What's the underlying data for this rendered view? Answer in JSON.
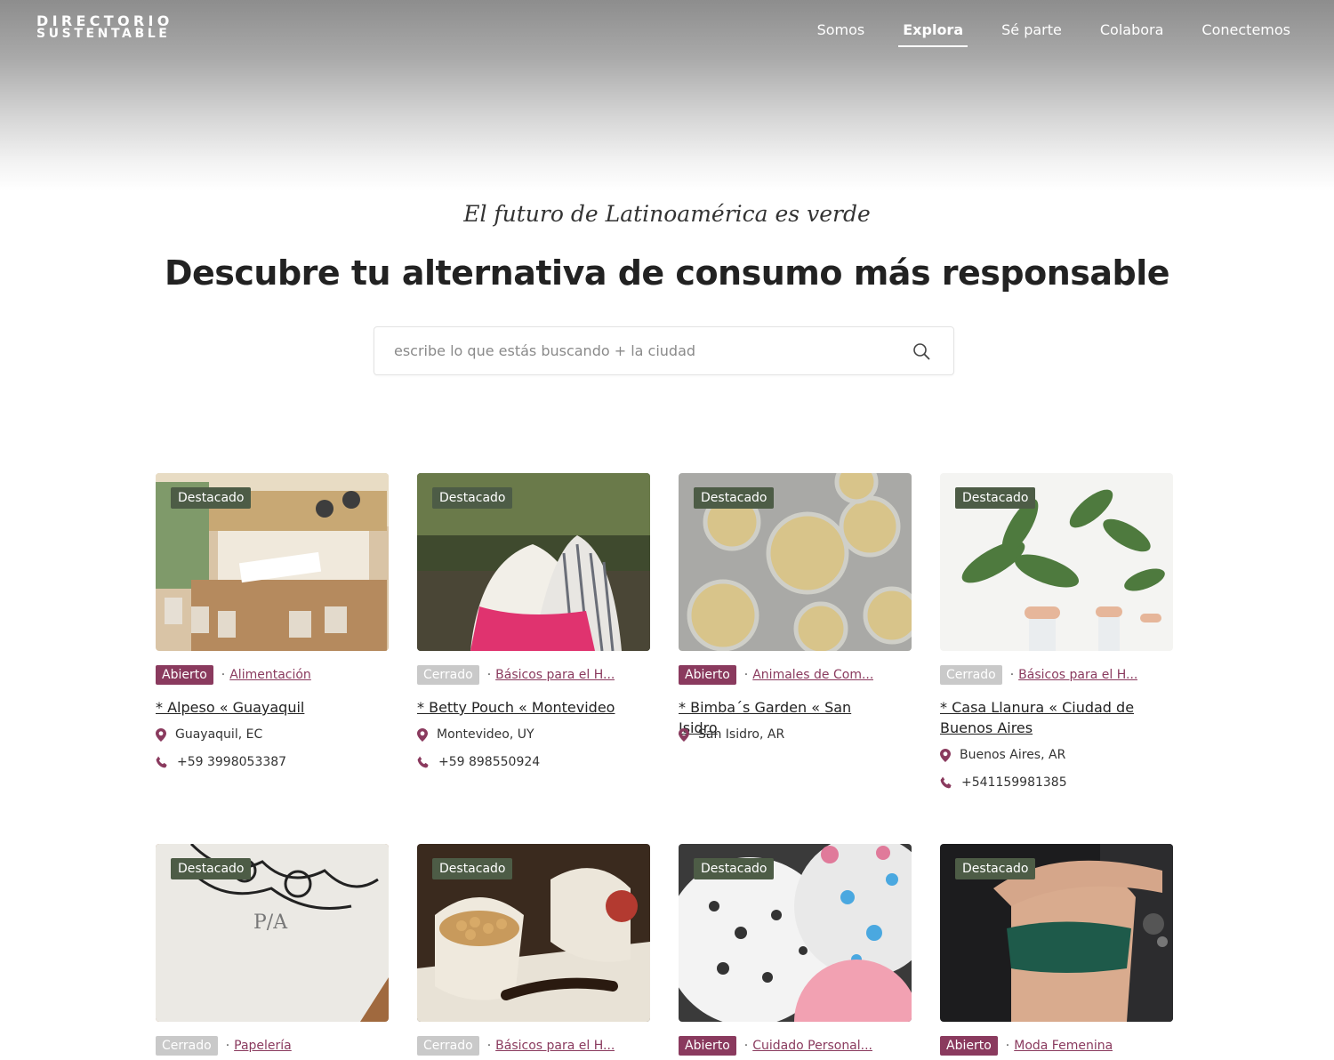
{
  "header": {
    "logo_line1": "DIRECTORIO",
    "logo_line2": "SUSTENTABLE",
    "nav": [
      "Somos",
      "Explora",
      "Sé parte",
      "Colabora",
      "Conectemos"
    ],
    "active_nav": "Explora"
  },
  "hero": {
    "tagline": "El futuro de Latinoamérica es verde",
    "headline": "Descubre tu alternativa de consumo más responsable",
    "search_placeholder": "escribe lo que estás buscando + la ciudad"
  },
  "badge_label": "Destacado",
  "colors": {
    "accent": "#8a3a5e",
    "featured": "#4d5c46",
    "closed": "#c9c9c9"
  },
  "cards": [
    {
      "status": "Abierto",
      "open": true,
      "category": "Alimentación",
      "title": "* Alpeso « Guayaquil",
      "location": "Guayaquil, EC",
      "phone": "+59 3998053387"
    },
    {
      "status": "Cerrado",
      "open": false,
      "category": "Básicos para el H...",
      "title": "* Betty Pouch « Montevideo",
      "location": "Montevideo, UY",
      "phone": "+59 898550924"
    },
    {
      "status": "Abierto",
      "open": true,
      "category": "Animales de Com...",
      "title": "* Bimba´s Garden « San Isidro",
      "location": "San Isidro, AR",
      "phone": ""
    },
    {
      "status": "Cerrado",
      "open": false,
      "category": "Básicos para el H...",
      "title": "* Casa Llanura « Ciudad de Buenos Aires",
      "location": "Buenos Aires, AR",
      "phone": "+541159981385"
    },
    {
      "status": "Cerrado",
      "open": false,
      "category": "Papelería",
      "title": "",
      "location": "",
      "phone": ""
    },
    {
      "status": "Cerrado",
      "open": false,
      "category": "Básicos para el H...",
      "title": "",
      "location": "",
      "phone": ""
    },
    {
      "status": "Abierto",
      "open": true,
      "category": "Cuidado Personal...",
      "title": "",
      "location": "",
      "phone": ""
    },
    {
      "status": "Abierto",
      "open": true,
      "category": "Moda Femenina",
      "title": "",
      "location": "",
      "phone": ""
    }
  ]
}
